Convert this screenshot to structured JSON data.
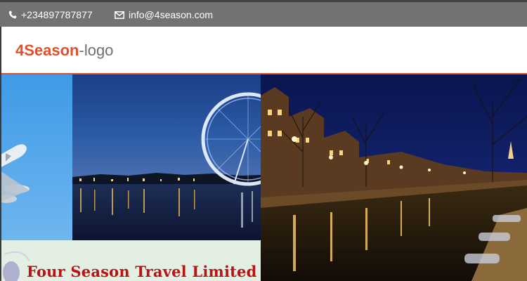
{
  "topbar": {
    "phone": {
      "icon": "phone-icon",
      "text": "+234897787877"
    },
    "email": {
      "icon": "envelope-icon",
      "text": "info@4season.com"
    }
  },
  "header": {
    "logo_brand": "4Season",
    "logo_suffix": "-logo"
  },
  "hero": {
    "caption": "Four Season Travel Limited",
    "images": [
      "airplane-sky-image",
      "london-eye-night-image",
      "amsterdam-canal-night-image"
    ]
  },
  "colors": {
    "topbar_bg": "#727272",
    "brand": "#e0502a",
    "header_border": "#d8542b",
    "caption": "#b71414"
  }
}
